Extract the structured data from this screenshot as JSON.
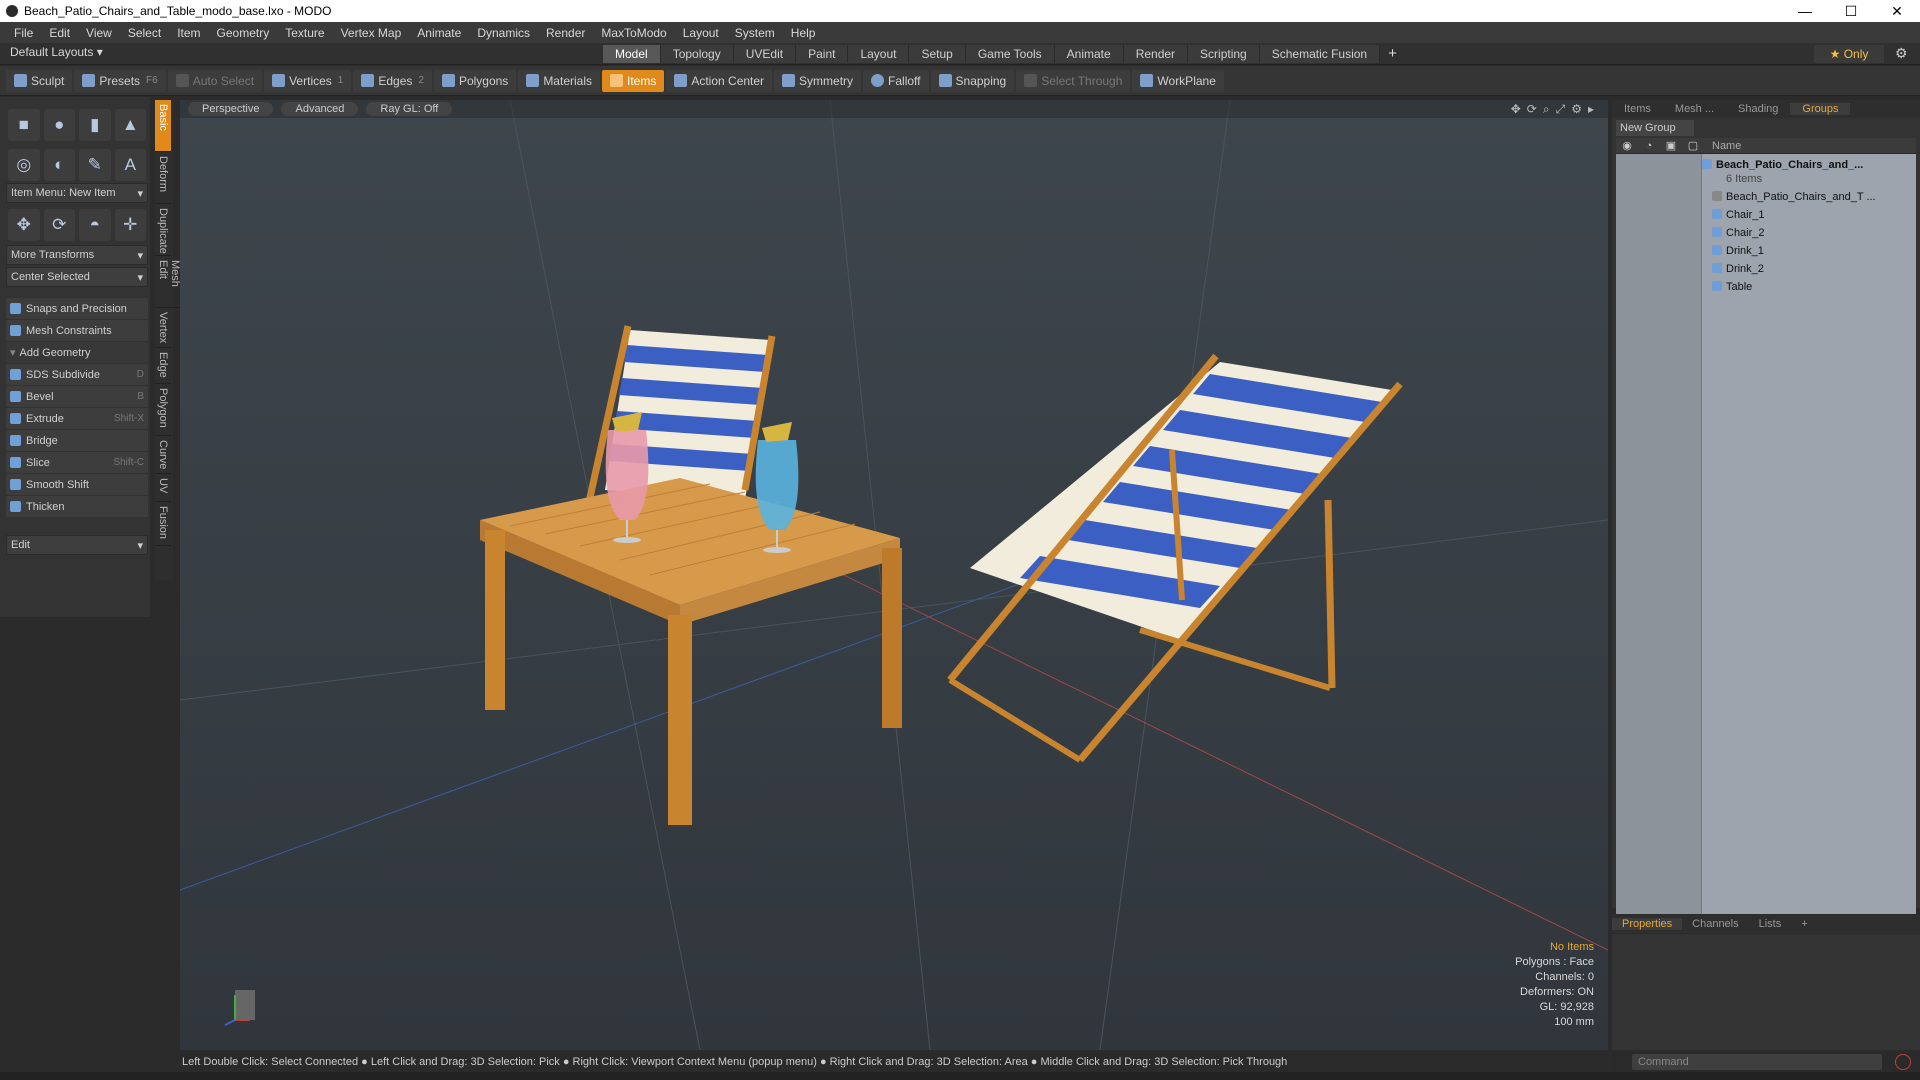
{
  "window": {
    "title": "Beach_Patio_Chairs_and_Table_modo_base.lxo - MODO",
    "minimize": "—",
    "maximize": "☐",
    "close": "✕"
  },
  "menu": [
    "File",
    "Edit",
    "View",
    "Select",
    "Item",
    "Geometry",
    "Texture",
    "Vertex Map",
    "Animate",
    "Dynamics",
    "Render",
    "MaxToModo",
    "Layout",
    "System",
    "Help"
  ],
  "layouts": "Default Layouts ▾",
  "main_tabs": [
    {
      "label": "Model",
      "active": true
    },
    {
      "label": "Topology"
    },
    {
      "label": "UVEdit"
    },
    {
      "label": "Paint"
    },
    {
      "label": "Layout"
    },
    {
      "label": "Setup"
    },
    {
      "label": "Game Tools"
    },
    {
      "label": "Animate"
    },
    {
      "label": "Render"
    },
    {
      "label": "Scripting"
    },
    {
      "label": "Schematic Fusion"
    }
  ],
  "only_label": "★ Only",
  "toolbar": {
    "sculpt": "Sculpt",
    "presets": "Presets",
    "presets_key": "F6",
    "auto_select": "Auto Select",
    "vertices": "Vertices",
    "vertices_count": "1",
    "edges": "Edges",
    "edges_count": "2",
    "polygons": "Polygons",
    "materials": "Materials",
    "items": "Items",
    "action_center": "Action Center",
    "symmetry": "Symmetry",
    "falloff": "Falloff",
    "snapping": "Snapping",
    "select_through": "Select Through",
    "workplane": "WorkPlane"
  },
  "left": {
    "item_menu": "Item Menu: New Item",
    "more_transforms": "More Transforms",
    "center_selected": "Center Selected",
    "snaps": "Snaps and Precision",
    "mesh_constraints": "Mesh Constraints",
    "add_geometry": "Add Geometry",
    "tools": [
      {
        "label": "SDS Subdivide",
        "key": "D"
      },
      {
        "label": "Bevel",
        "key": "B"
      },
      {
        "label": "Extrude",
        "key": "Shift-X"
      },
      {
        "label": "Bridge",
        "key": ""
      },
      {
        "label": "Slice",
        "key": "Shift-C"
      },
      {
        "label": "Smooth Shift",
        "key": ""
      },
      {
        "label": "Thicken",
        "key": ""
      }
    ],
    "edit": "Edit"
  },
  "side_tabs": [
    "Basic",
    "Deform",
    "Duplicate",
    "Mesh Edit",
    "Vertex",
    "Edge",
    "Polygon",
    "Curve",
    "UV",
    "Fusion"
  ],
  "viewport": {
    "perspective": "Perspective",
    "advanced": "Advanced",
    "raygl": "Ray GL: Off"
  },
  "info": {
    "line1": "No Items",
    "line2": "Polygons : Face",
    "line3": "Channels: 0",
    "line4": "Deformers: ON",
    "line5": "GL: 92,928",
    "line6": "100 mm"
  },
  "status": "Left Double Click: Select Connected ● Left Click and Drag: 3D Selection: Pick ● Right Click: Viewport Context Menu (popup menu) ● Right Click and Drag: 3D Selection: Area ● Middle Click and Drag: 3D Selection: Pick Through",
  "right": {
    "tabs": [
      {
        "label": "Items"
      },
      {
        "label": "Mesh ..."
      },
      {
        "label": "Shading"
      },
      {
        "label": "Groups",
        "active": true
      }
    ],
    "new_group": "New Group",
    "name_col": "Name",
    "group_name": "Beach_Patio_Chairs_and_...",
    "group_count": "6 Items",
    "items": [
      "Beach_Patio_Chairs_and_T ...",
      "Chair_1",
      "Chair_2",
      "Drink_1",
      "Drink_2",
      "Table"
    ]
  },
  "prop_tabs": [
    {
      "label": "Properties",
      "active": true
    },
    {
      "label": "Channels"
    },
    {
      "label": "Lists"
    },
    {
      "label": "+"
    }
  ],
  "command_placeholder": "Command"
}
